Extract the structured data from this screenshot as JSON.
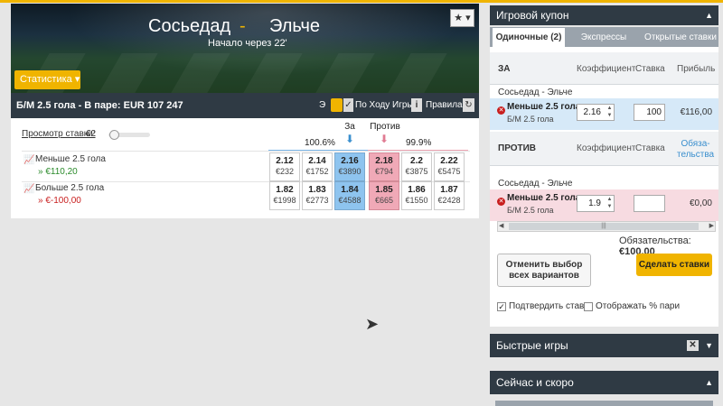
{
  "event": {
    "home": "Сосьедад",
    "separator": "-",
    "away": "Эльче",
    "start_info": "Начало через 22'",
    "favorite_icon": "star-icon",
    "stats_button": "Статистика ▾"
  },
  "market": {
    "title": "Б/М 2.5 гола - В паре: EUR 107 247",
    "e_label": "Э",
    "inplay_label": "По Ходу Игры",
    "rules_label": "Правила",
    "view_stakes_label": "Просмотр ставки:",
    "view_stakes_amount": "€2",
    "back_header": "За",
    "lay_header": "Против",
    "back_pct": "100.6%",
    "lay_pct": "99.9%",
    "runners": [
      {
        "name": "Меньше 2.5 гола",
        "pl": "» €110,20",
        "odds": [
          {
            "price": "2.12",
            "volume": "€232"
          },
          {
            "price": "2.14",
            "volume": "€1752"
          },
          {
            "price": "2.16",
            "volume": "€3890"
          },
          {
            "price": "2.18",
            "volume": "€794"
          },
          {
            "price": "2.2",
            "volume": "€3875"
          },
          {
            "price": "2.22",
            "volume": "€5475"
          }
        ]
      },
      {
        "name": "Больше 2.5 гола",
        "pl": "» €-100,00",
        "odds": [
          {
            "price": "1.82",
            "volume": "€1998"
          },
          {
            "price": "1.83",
            "volume": "€2773"
          },
          {
            "price": "1.84",
            "volume": "€4588"
          },
          {
            "price": "1.85",
            "volume": "€665"
          },
          {
            "price": "1.86",
            "volume": "€1550"
          },
          {
            "price": "1.87",
            "volume": "€2428"
          }
        ]
      }
    ]
  },
  "coupon": {
    "title": "Игровой купон",
    "tabs": [
      "Одиночные (2)",
      "Экспрессы",
      "Открытые ставки"
    ],
    "back_section": {
      "side": "ЗА",
      "col_odds": "Коэффициент",
      "col_stake": "Ставка",
      "col_profit": "Прибыль",
      "event": "Сосьедад - Эльче",
      "selection": "Меньше 2.5 гола",
      "market": "Б/М 2.5 гола",
      "odds": "2.16",
      "stake": "100",
      "profit": "€116,00"
    },
    "lay_section": {
      "side": "ПРОТИВ",
      "col_odds": "Коэффициент",
      "col_stake": "Ставка",
      "col_liability": "Обяза-\nтельства",
      "event": "Сосьедад - Эльче",
      "selection": "Меньше 2.5 гола",
      "market": "Б/М 2.5 гола",
      "odds": "1.9",
      "stake": "",
      "liability": "€0,00"
    },
    "liability_label": "Обязательства:",
    "liability_value": "€100,00",
    "cancel_button": "Отменить выбор всех вариантов",
    "place_button": "Сделать ставки",
    "confirm_label": "Подтвердить ставки",
    "show_pct_label": "Отображать % пари"
  },
  "quick_games": {
    "title": "Быстрые игры"
  },
  "now_soon": {
    "title": "Сейчас и скоро"
  },
  "colors": {
    "accent": "#f0b400",
    "header_dark": "#2f3a44",
    "back_best": "#8ec4ef",
    "lay_best": "#f0a9b7"
  }
}
